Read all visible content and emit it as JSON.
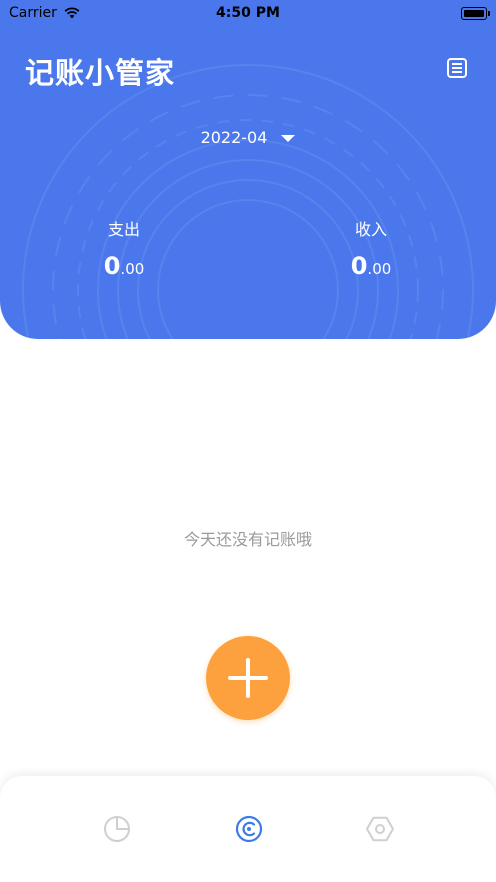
{
  "status_bar": {
    "carrier": "Carrier",
    "time": "4:50 PM"
  },
  "header": {
    "title": "记账小管家",
    "month": "2022-04",
    "expense": {
      "label": "支出",
      "int": "0",
      "dec": ".00"
    },
    "income": {
      "label": "收入",
      "int": "0",
      "dec": ".00"
    }
  },
  "main": {
    "empty_text": "今天还没有记账哦"
  },
  "tabbar": {
    "items": [
      "chart-pie-icon",
      "ledger-icon",
      "settings-hex-icon"
    ],
    "active": 1
  },
  "colors": {
    "primary": "#4a78ec",
    "accent": "#fca13d",
    "tab_active": "#3b7be8",
    "tab_inactive": "#cfcfcf"
  }
}
